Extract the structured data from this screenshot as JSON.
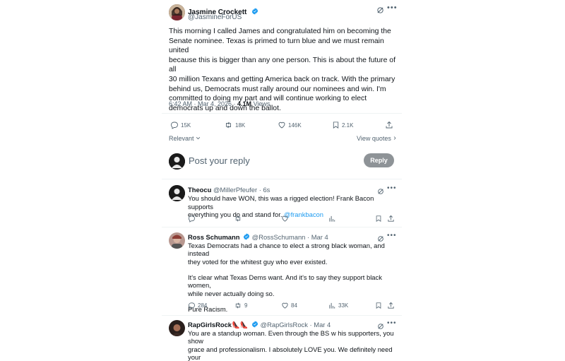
{
  "main_tweet": {
    "author_name": "Jasmine Crockett",
    "author_handle": "@JasmineForUS",
    "text_lines": [
      "This morning I called James and congratulated him on becoming the",
      "Senate nominee. Texas is primed to turn blue and we must remain united",
      "because this is bigger than any one person. This is about the future of all",
      "30 million Texans and getting America back on track. With the primary",
      "behind us, Democrats must rally around our nominees and win. I'm",
      "committed to doing my part and will continue working to elect",
      "democrats up and down the ballot."
    ],
    "timestamp": "6:42 AM · Mar 4, 2026 · ",
    "views_count": "4.1M",
    "views_label": " Views",
    "replies": "15K",
    "reposts": "18K",
    "likes": "146K",
    "bookmarks": "2.1K"
  },
  "sort": {
    "relevant_label": "Relevant",
    "view_quotes_label": "View quotes"
  },
  "composer": {
    "placeholder": "Post your reply",
    "reply_button": "Reply"
  },
  "replies": [
    {
      "name": "Theocu",
      "handle": "@MillerPfeufer",
      "time": "6s",
      "lines": [
        "You should have WON, this was a rigged election!  Frank Bacon supports",
        "everything you do and stand for."
      ],
      "mention": "@frankbacon",
      "replies": "",
      "reposts": "",
      "likes": "",
      "views": ""
    },
    {
      "name": "Ross Schumann",
      "handle": "@RossSchumann",
      "time": "Mar 4",
      "lines": [
        "Texas Democrats had a chance to elect a strong black woman, and instead",
        "they voted for the whitest guy who ever existed.",
        "",
        "It's clear what Texas Dems want. And it's to say they support black women,",
        "while never actually doing so.",
        "",
        "Pure Racism."
      ],
      "replies": "284",
      "reposts": "9",
      "likes": "84",
      "views": "33K"
    },
    {
      "name": "RapGirlsRock👠👠",
      "handle": "@RapGirlsRock",
      "time": "Mar 4",
      "lines": [
        "You are a standup woman. Even through the BS w his supporters, you show",
        "grace and professionalism. I absolutely LOVE you. We definitely need your"
      ]
    }
  ],
  "colors": {
    "accent": "#1d9bf0",
    "muted": "#536471",
    "text": "#0f1419",
    "reply_button": "#8e9397"
  }
}
